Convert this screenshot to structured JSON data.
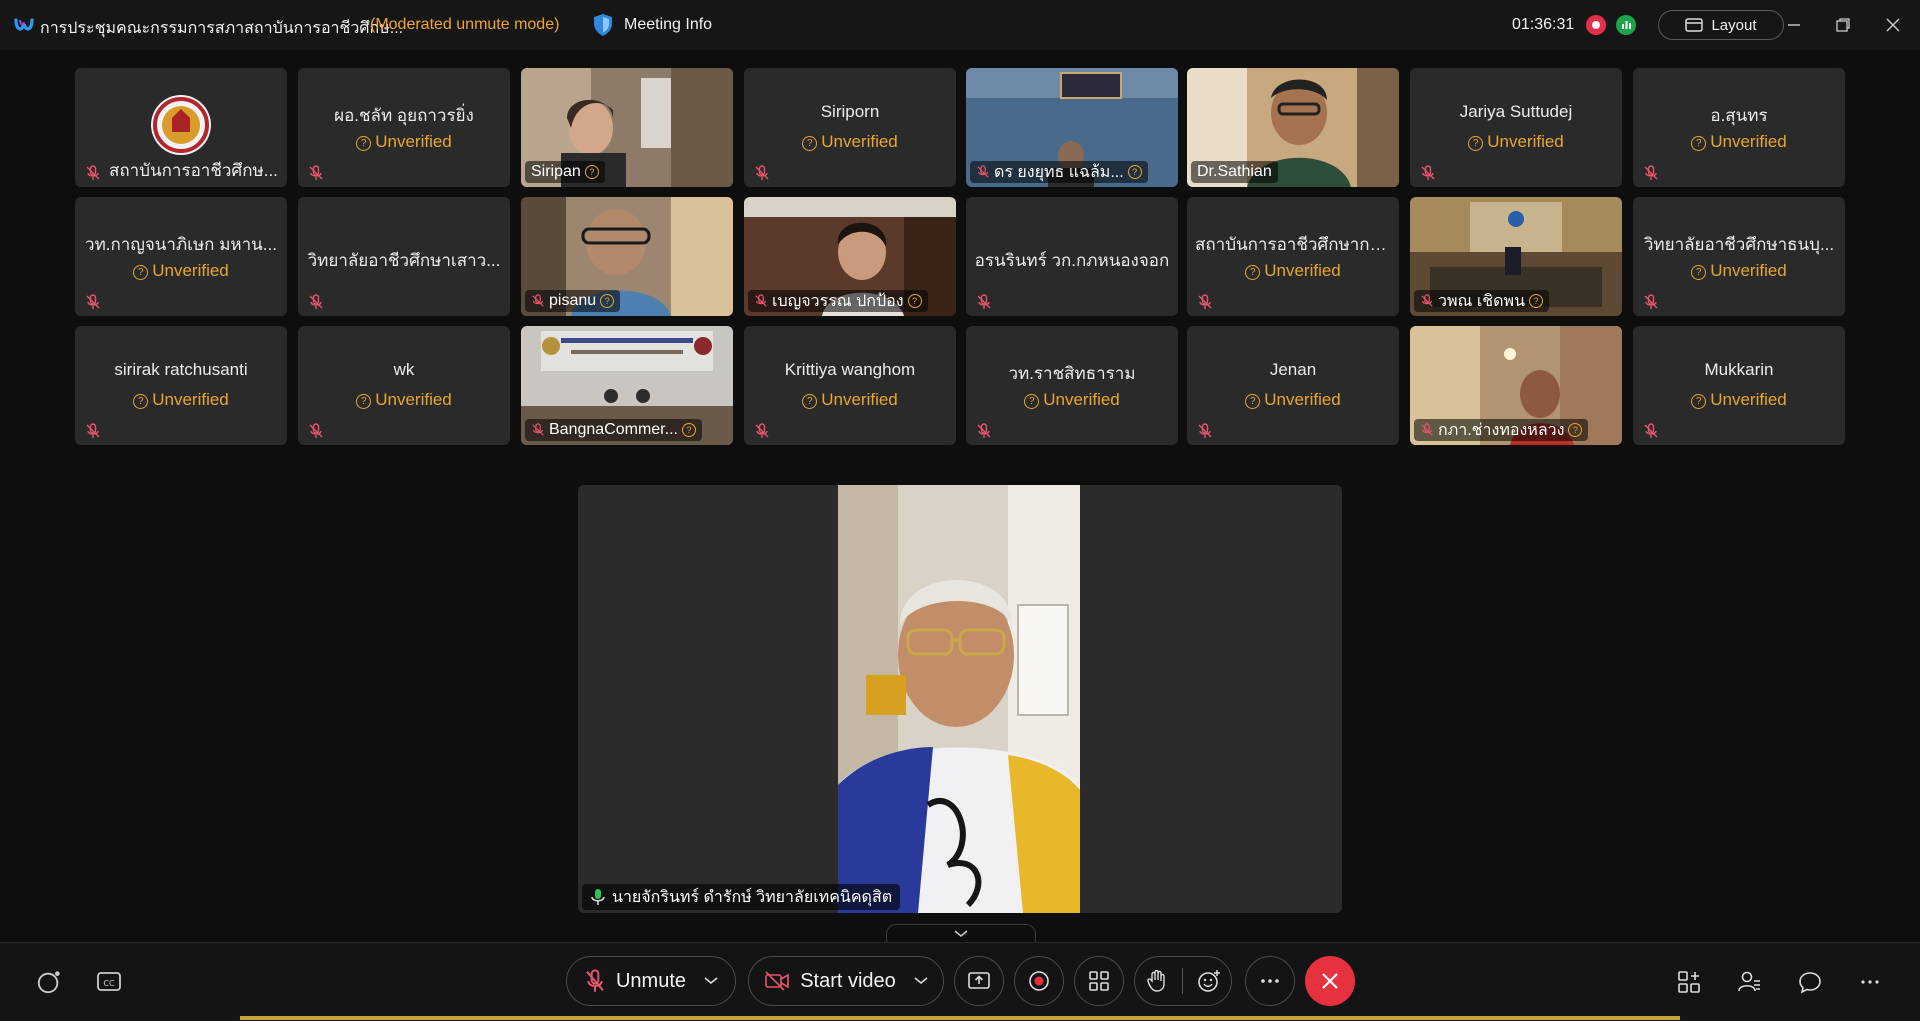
{
  "titlebar": {
    "meeting_title": "การประชุมคณะกรรมการสภาสถาบันการอาชีวศึกษ...",
    "mode": "(Moderated unmute mode)",
    "meeting_info": "Meeting Info",
    "timer": "01:36:31",
    "layout": "Layout"
  },
  "labels": {
    "unverified": "Unverified"
  },
  "tiles": [
    {
      "name": "สถาบันการอาชีวศึกษ..."
    },
    {
      "name": "ผอ.ชลัท อุยถาวรยิ่ง"
    },
    {
      "name": "Siripan"
    },
    {
      "name": "Siriporn"
    },
    {
      "name": "ดร ยงยุทธ แฉล้ม..."
    },
    {
      "name": "Dr.Sathian"
    },
    {
      "name": "Jariya Suttudej"
    },
    {
      "name": "อ.สุนทร"
    },
    {
      "name": "วท.กาญจนาภิเษก มหาน..."
    },
    {
      "name": "วิทยาลัยอาชีวศึกษาเสาว..."
    },
    {
      "name": "pisanu"
    },
    {
      "name": "เบญจวรรณ ปกป้อง"
    },
    {
      "name": "อรนรินทร์ วก.กภหนองจอก"
    },
    {
      "name": "สถาบันการอาชีวศึกษากรุ..."
    },
    {
      "name": "วพณ เชิดพน"
    },
    {
      "name": "วิทยาลัยอาชีวศึกษาธนบุ..."
    },
    {
      "name": "sirirak ratchusanti"
    },
    {
      "name": "wk"
    },
    {
      "name": "BangnaCommer..."
    },
    {
      "name": "Krittiya wanghom"
    },
    {
      "name": "วท.ราชสิทธาราม"
    },
    {
      "name": "Jenan"
    },
    {
      "name": "กภา.ช่างทองหลวง"
    },
    {
      "name": "Mukkarin"
    }
  ],
  "active_speaker": {
    "name": "นายจักรินทร์ ดำรักษ์ วิทยาลัยเทคนิคดุสิต"
  },
  "controls": {
    "unmute": "Unmute",
    "start_video": "Start video"
  },
  "colors": {
    "accent_orange": "#e8a531",
    "record_red": "#e0304a",
    "end_red": "#e6323e",
    "tile_bg": "#2a2a2a"
  },
  "icons": [
    "webex-logo-icon",
    "shield-icon",
    "record-icon",
    "stats-icon",
    "layout-icon",
    "minimize-icon",
    "restore-icon",
    "close-icon",
    "mic-off-icon",
    "unverified-icon",
    "mic-on-icon",
    "chevron-down-icon",
    "captions-icon",
    "assistant-icon",
    "share-icon",
    "grid-icon",
    "hand-icon",
    "reaction-icon",
    "more-icon",
    "end-call-icon",
    "apps-icon",
    "participants-icon",
    "chat-icon"
  ]
}
